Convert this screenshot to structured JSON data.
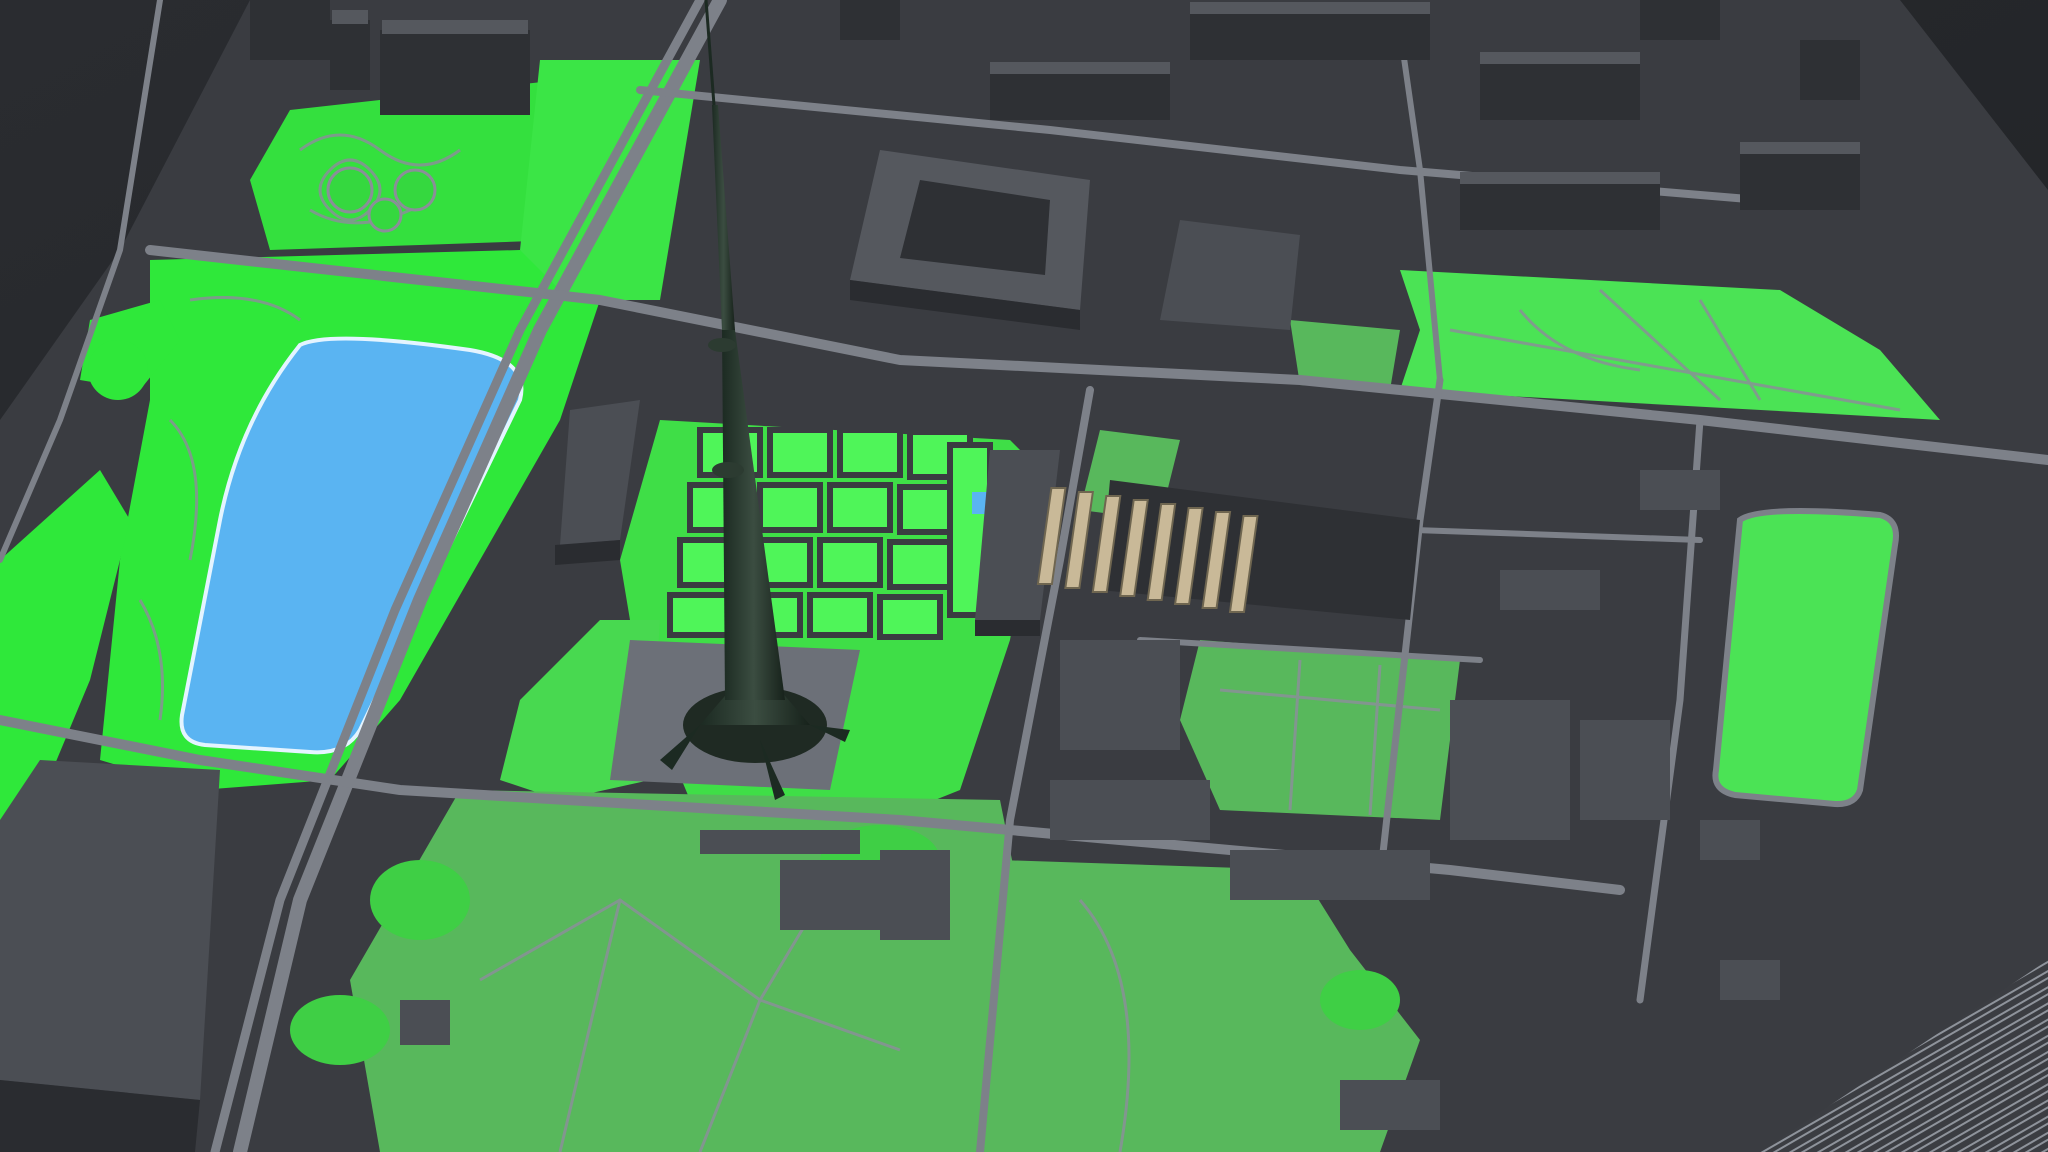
{
  "scene": {
    "kind": "3d-city-map-render",
    "labels_visible": false,
    "colors": {
      "ground": "#3a3c41",
      "void": "#26282c",
      "park_bright": "#2fe83a",
      "park_mid": "#3fcf45",
      "park_muted": "#58b85c",
      "grass_light": "#4cde55",
      "water": "#5ab4f2",
      "road": "#7d8189",
      "building_top": "#55585e",
      "building_side": "#2e3034",
      "tower": "#25342a",
      "plaza": "#6c7078"
    },
    "features": [
      {
        "name": "pond",
        "type": "water-body"
      },
      {
        "name": "tv-tower",
        "type": "landmark"
      },
      {
        "name": "city-park",
        "type": "park"
      },
      {
        "name": "railway-tracks",
        "type": "transport"
      }
    ]
  }
}
